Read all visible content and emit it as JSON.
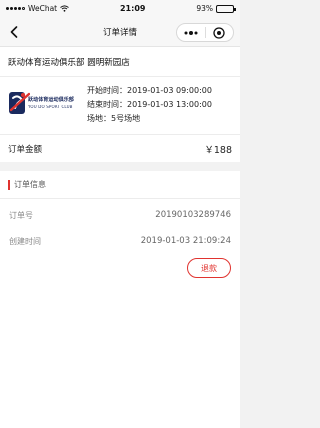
{
  "status_bar": {
    "carrier": "WeChat",
    "time": "21:09",
    "battery_percent": "93%",
    "battery_level": 0.93
  },
  "nav": {
    "title": "订单详情",
    "back_icon": "chevron-left-icon",
    "menu_icon": "more-dots-icon",
    "close_icon": "target-circle-icon"
  },
  "venue": {
    "name": "跃动体育运动俱乐部 圆明新园店",
    "logo": {
      "brand_cn": "跃动体育运动俱乐部",
      "brand_en": "YOU DO SPORT CLUB",
      "primary_color": "#1a2a5e",
      "accent_color": "#e0332f"
    },
    "start_time": "开始时间：2019-01-03 09:00:00",
    "end_time": "结束时间：2019-01-03 13:00:00",
    "court": "场地：5号场地"
  },
  "amount": {
    "label": "订单金额",
    "value": "￥188"
  },
  "order_info": {
    "title": "订单信息",
    "order_no_label": "订单号",
    "order_no_value": "20190103289746",
    "created_label": "创建时间",
    "created_value": "2019-01-03 21:09:24"
  },
  "actions": {
    "refund_label": "退款"
  },
  "colors": {
    "accent": "#e0332f",
    "page_bg": "#f2f2f2"
  }
}
